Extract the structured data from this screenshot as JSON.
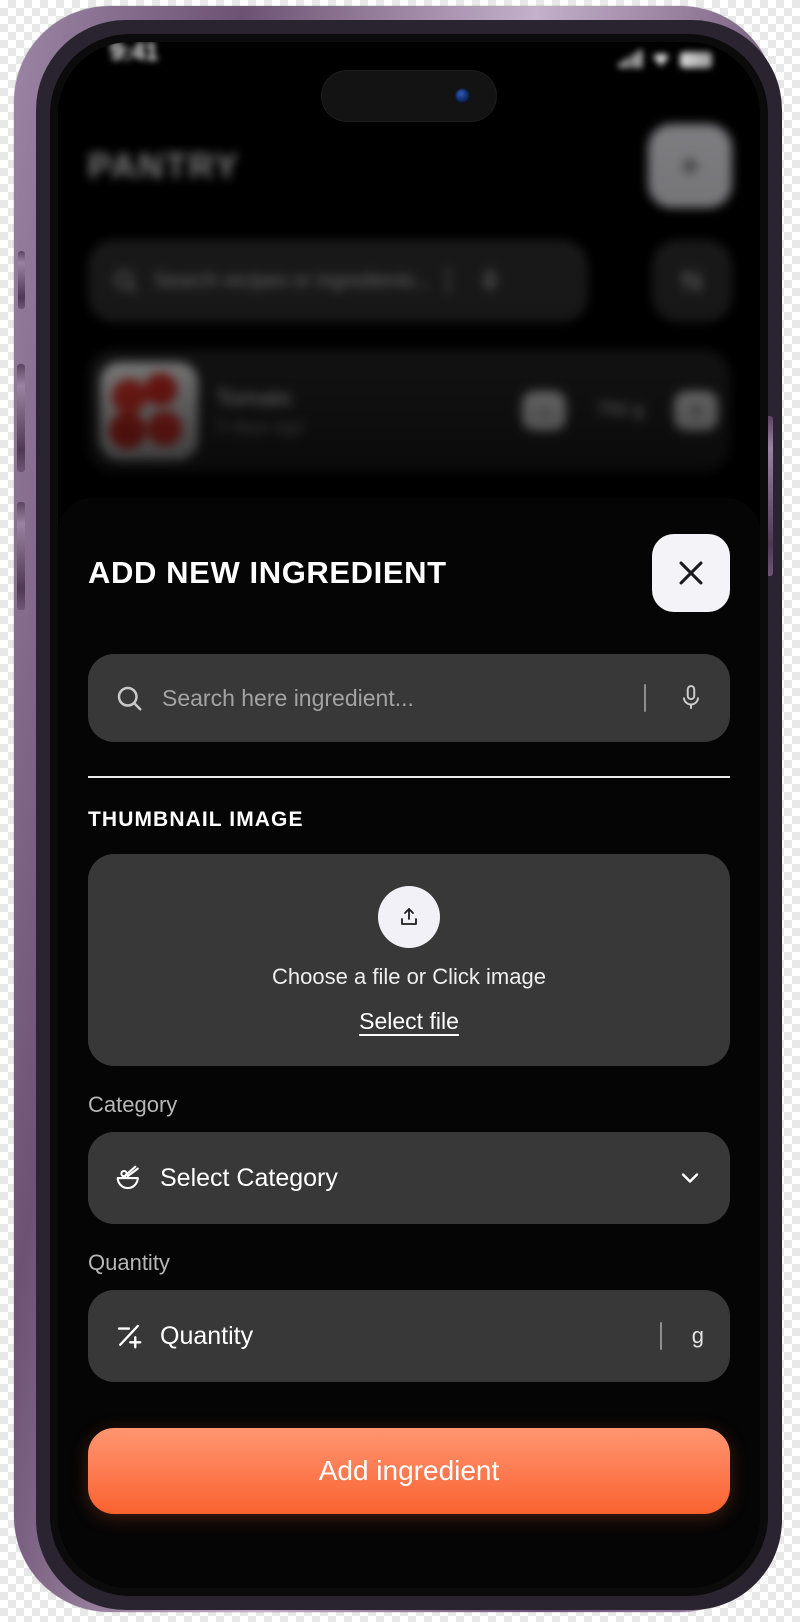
{
  "device": {
    "frame_color": "#6d5273",
    "screen_bg": "#000000"
  },
  "status_bar": {
    "time": "9:41",
    "signal_icon": "cellular-signal-icon",
    "wifi_icon": "wifi-icon",
    "battery_icon": "battery-icon"
  },
  "background_app": {
    "title": "PANTRY",
    "add_button_label": "+",
    "search": {
      "placeholder": "Search recipes or ingredients...",
      "search_icon": "search-icon",
      "mic_icon": "microphone-icon"
    },
    "filter_icon": "filter-sliders-icon",
    "item_card": {
      "name": "Tomato",
      "subtitle": "2 days ago",
      "decrement_label": "–",
      "quantity": "750 g",
      "increment_label": "+",
      "thumbnail": "tomato-thumbnail"
    }
  },
  "modal": {
    "title": "ADD NEW INGREDIENT",
    "close_icon": "close-icon",
    "search": {
      "placeholder": "Search here ingredient...",
      "value": "",
      "search_icon": "search-icon",
      "mic_icon": "microphone-icon"
    },
    "thumbnail_section": {
      "label": "THUMBNAIL IMAGE",
      "upload_icon": "upload-icon",
      "caption": "Choose a file or Click image",
      "select_link": "Select file"
    },
    "category": {
      "label": "Category",
      "value": "Select Category",
      "leading_icon": "bowl-chopsticks-icon",
      "chevron_icon": "chevron-down-icon"
    },
    "quantity": {
      "label": "Quantity",
      "placeholder": "Quantity",
      "value": "",
      "leading_icon": "scale-icon",
      "unit": "g"
    },
    "submit": {
      "label": "Add ingredient",
      "color_from": "#ff9671",
      "color_to": "#f9622f"
    }
  }
}
